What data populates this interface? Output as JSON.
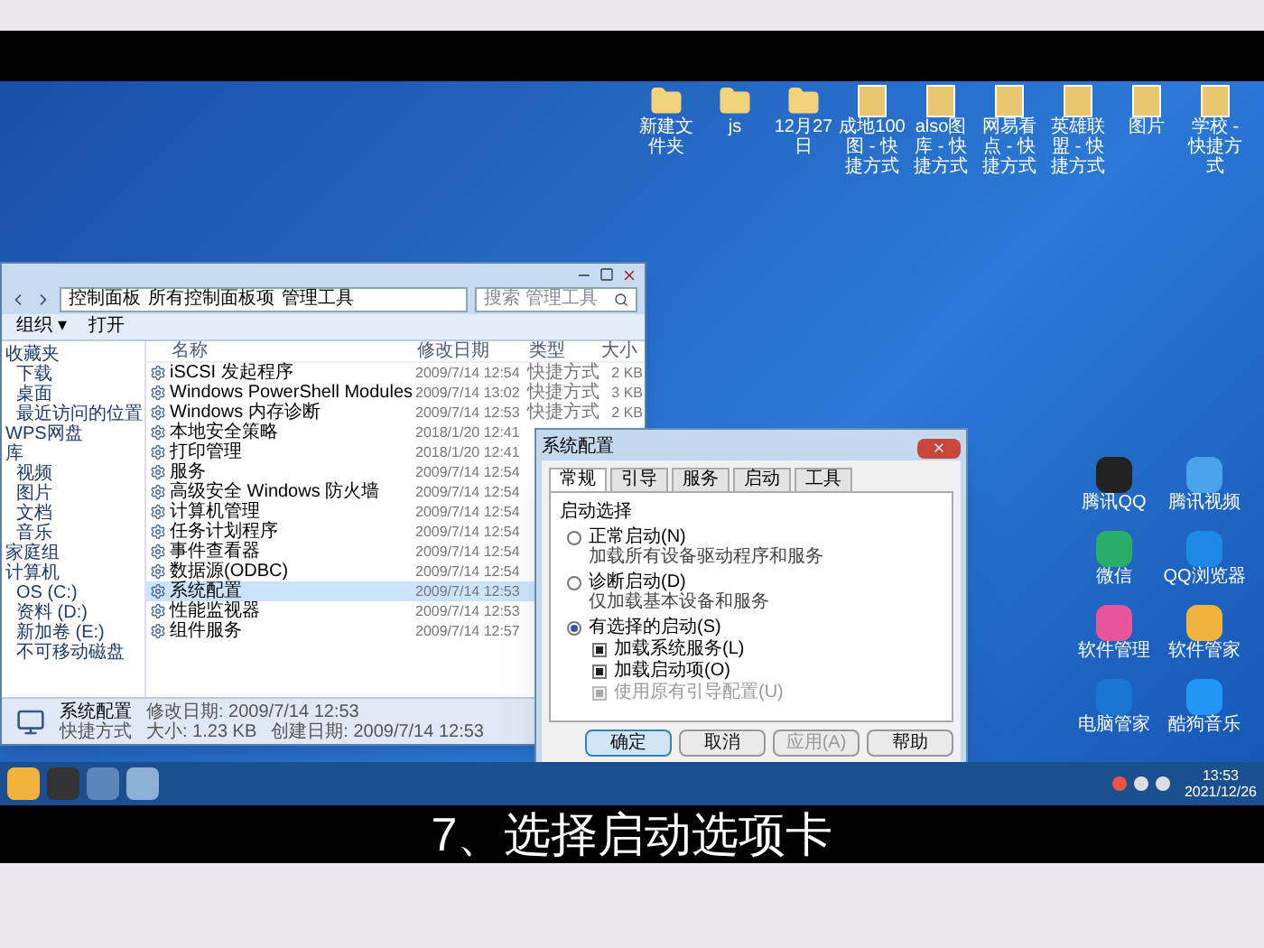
{
  "desktop_icons_top": [
    {
      "label": "新建文件夹",
      "kind": "folder"
    },
    {
      "label": "js",
      "kind": "folder"
    },
    {
      "label": "12月27日",
      "kind": "folder"
    },
    {
      "label": "成地100图 - 快捷方式",
      "kind": "shortcut"
    },
    {
      "label": "also图库 - 快捷方式",
      "kind": "shortcut"
    },
    {
      "label": "网易看点 - 快捷方式",
      "kind": "shortcut"
    },
    {
      "label": "英雄联盟 - 快捷方式",
      "kind": "shortcut"
    },
    {
      "label": "图片",
      "kind": "shortcut"
    },
    {
      "label": "学校 - 快捷方式",
      "kind": "shortcut"
    }
  ],
  "desktop_icons_right": [
    {
      "label": "腾讯QQ",
      "color": "#222222"
    },
    {
      "label": "腾讯视频",
      "color": "#4aa3e8"
    },
    {
      "label": "微信",
      "color": "#2aae67"
    },
    {
      "label": "QQ浏览器",
      "color": "#1e88e5"
    },
    {
      "label": "软件管理",
      "color": "#e8559a"
    },
    {
      "label": "软件管家",
      "color": "#f2b33d"
    },
    {
      "label": "电脑管家",
      "color": "#1976d2"
    },
    {
      "label": "酷狗音乐",
      "color": "#2196f3"
    }
  ],
  "explorer": {
    "breadcrumb": [
      "控制面板",
      "所有控制面板项",
      "管理工具"
    ],
    "search": {
      "placeholder": "搜索 管理工具"
    },
    "toolbar": [
      "组织 ▾",
      "打开"
    ],
    "sidebar": [
      {
        "label": "收藏夹",
        "children": [
          {
            "label": "下载"
          },
          {
            "label": "桌面"
          },
          {
            "label": "最近访问的位置"
          }
        ]
      },
      {
        "label": "WPS网盘"
      },
      {
        "label": "库",
        "children": [
          {
            "label": "视频"
          },
          {
            "label": "图片"
          },
          {
            "label": "文档"
          },
          {
            "label": "音乐"
          }
        ]
      },
      {
        "label": "家庭组"
      },
      {
        "label": "计算机",
        "children": [
          {
            "label": "OS (C:)"
          },
          {
            "label": "资料 (D:)"
          },
          {
            "label": "新加卷 (E:)"
          },
          {
            "label": "不可移动磁盘"
          }
        ]
      }
    ],
    "columns": [
      "名称",
      "修改日期",
      "类型",
      "大小"
    ],
    "rows": [
      {
        "name": "iSCSI 发起程序",
        "date": "2009/7/14 12:54",
        "type": "快捷方式",
        "size": "2 KB",
        "selected": false
      },
      {
        "name": "Windows PowerShell Modules",
        "date": "2009/7/14 13:02",
        "type": "快捷方式",
        "size": "3 KB",
        "selected": false
      },
      {
        "name": "Windows 内存诊断",
        "date": "2009/7/14 12:53",
        "type": "快捷方式",
        "size": "2 KB",
        "selected": false
      },
      {
        "name": "本地安全策略",
        "date": "2018/1/20 12:41",
        "selected": false
      },
      {
        "name": "打印管理",
        "date": "2018/1/20 12:41",
        "selected": false
      },
      {
        "name": "服务",
        "date": "2009/7/14 12:54",
        "selected": false
      },
      {
        "name": "高级安全 Windows 防火墙",
        "date": "2009/7/14 12:54",
        "selected": false
      },
      {
        "name": "计算机管理",
        "date": "2009/7/14 12:54",
        "selected": false
      },
      {
        "name": "任务计划程序",
        "date": "2009/7/14 12:54",
        "selected": false
      },
      {
        "name": "事件查看器",
        "date": "2009/7/14 12:54",
        "selected": false
      },
      {
        "name": "数据源(ODBC)",
        "date": "2009/7/14 12:54",
        "selected": false
      },
      {
        "name": "系统配置",
        "date": "2009/7/14 12:53",
        "selected": true
      },
      {
        "name": "性能监视器",
        "date": "2009/7/14 12:53",
        "selected": false
      },
      {
        "name": "组件服务",
        "date": "2009/7/14 12:57",
        "selected": false
      }
    ],
    "status": {
      "name": "系统配置",
      "modified": "修改日期: 2009/7/14 12:53",
      "created": "创建日期: 2009/7/14 12:53",
      "type": "快捷方式",
      "size": "大小: 1.23 KB"
    }
  },
  "dialog": {
    "title": "系统配置",
    "tabs": [
      {
        "label": "常规",
        "selected": true
      },
      {
        "label": "引导",
        "selected": false
      },
      {
        "label": "服务",
        "selected": false
      },
      {
        "label": "启动",
        "selected": false
      },
      {
        "label": "工具",
        "selected": false
      }
    ],
    "group_label": "启动选择",
    "options": [
      {
        "label": "正常启动(N)",
        "description": "加载所有设备驱动程序和服务",
        "selected": false
      },
      {
        "label": "诊断启动(D)",
        "description": "仅加载基本设备和服务",
        "selected": false
      },
      {
        "label": "有选择的启动(S)",
        "selected": true,
        "children": [
          {
            "label": "加载系统服务(L)",
            "checked": true,
            "disabled": false
          },
          {
            "label": "加载启动项(O)",
            "checked": true,
            "disabled": false
          },
          {
            "label": "使用原有引导配置(U)",
            "checked": true,
            "disabled": true
          }
        ]
      }
    ],
    "buttons": [
      {
        "label": "确定",
        "kind": "default",
        "disabled": false
      },
      {
        "label": "取消",
        "kind": "normal",
        "disabled": false
      },
      {
        "label": "应用(A)",
        "kind": "normal",
        "disabled": true
      },
      {
        "label": "帮助",
        "kind": "normal",
        "disabled": false
      }
    ]
  },
  "taskbar": {
    "time": "13:53",
    "date": "2021/12/26"
  },
  "caption": "7、选择启动选项卡"
}
